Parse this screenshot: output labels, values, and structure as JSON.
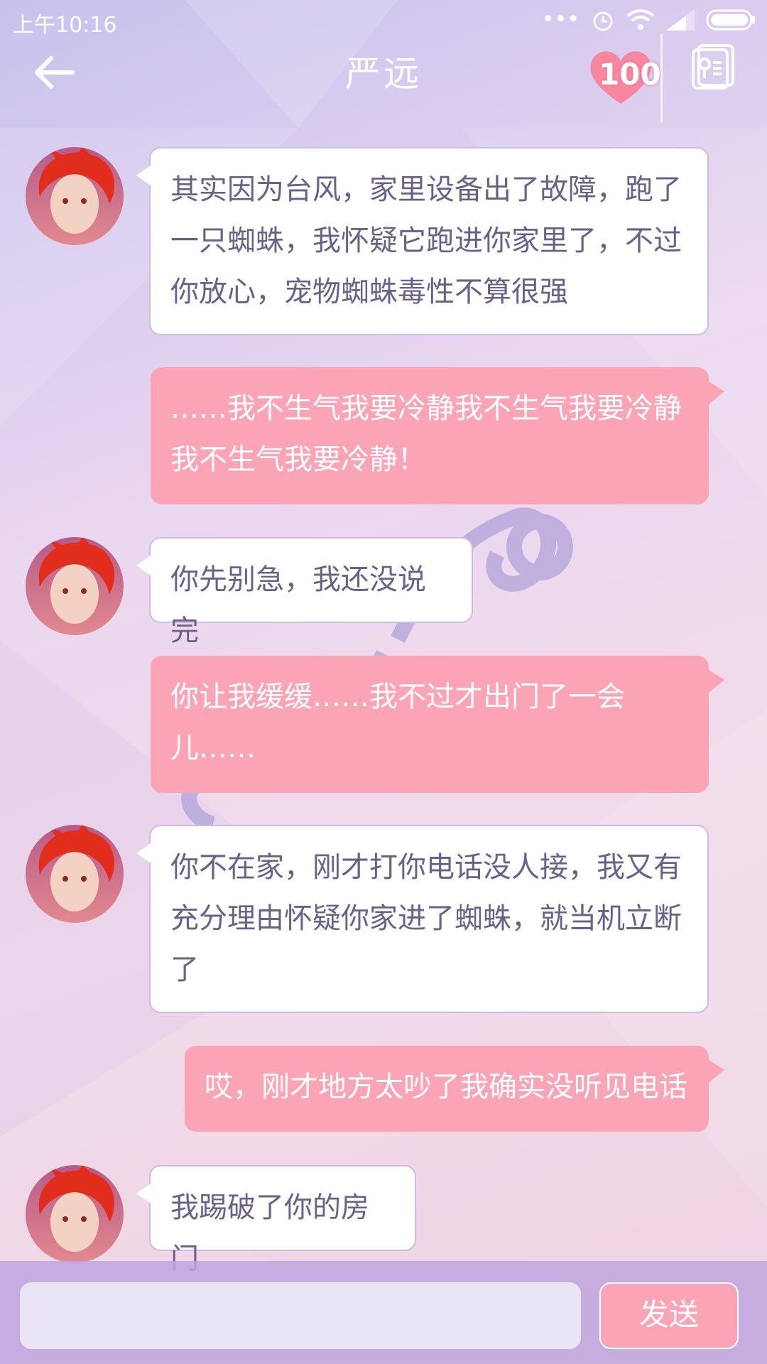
{
  "status_bar": {
    "time": "上午10:16",
    "icons": [
      "more-dots-icon",
      "alarm-icon",
      "wifi-icon",
      "signal-icon",
      "battery-icon"
    ]
  },
  "header": {
    "title": "严远",
    "affection": "100"
  },
  "messages": [
    {
      "side": "left",
      "text": "其实因为台风，家里设备出了故障，跑了一只蜘蛛，我怀疑它跑进你家里了，不过你放心，宠物蜘蛛毒性不算很强"
    },
    {
      "side": "right",
      "text": "……我不生气我要冷静我不生气我要冷静我不生气我要冷静！"
    },
    {
      "side": "left",
      "text": "你先别急，我还没说完"
    },
    {
      "side": "right",
      "text": "你让我缓缓……我不过才出门了一会儿……"
    },
    {
      "side": "left",
      "text": "你不在家，刚才打你电话没人接，我又有充分理由怀疑你家进了蜘蛛，就当机立断了"
    },
    {
      "side": "right",
      "text": "哎，刚才地方太吵了我确实没听见电话"
    },
    {
      "side": "left",
      "text": "我踢破了你的房门"
    }
  ],
  "composer": {
    "input_value": "",
    "send_label": "发送"
  },
  "colors": {
    "right_bubble": "#fba4b6",
    "left_text": "#6c5f8c"
  }
}
